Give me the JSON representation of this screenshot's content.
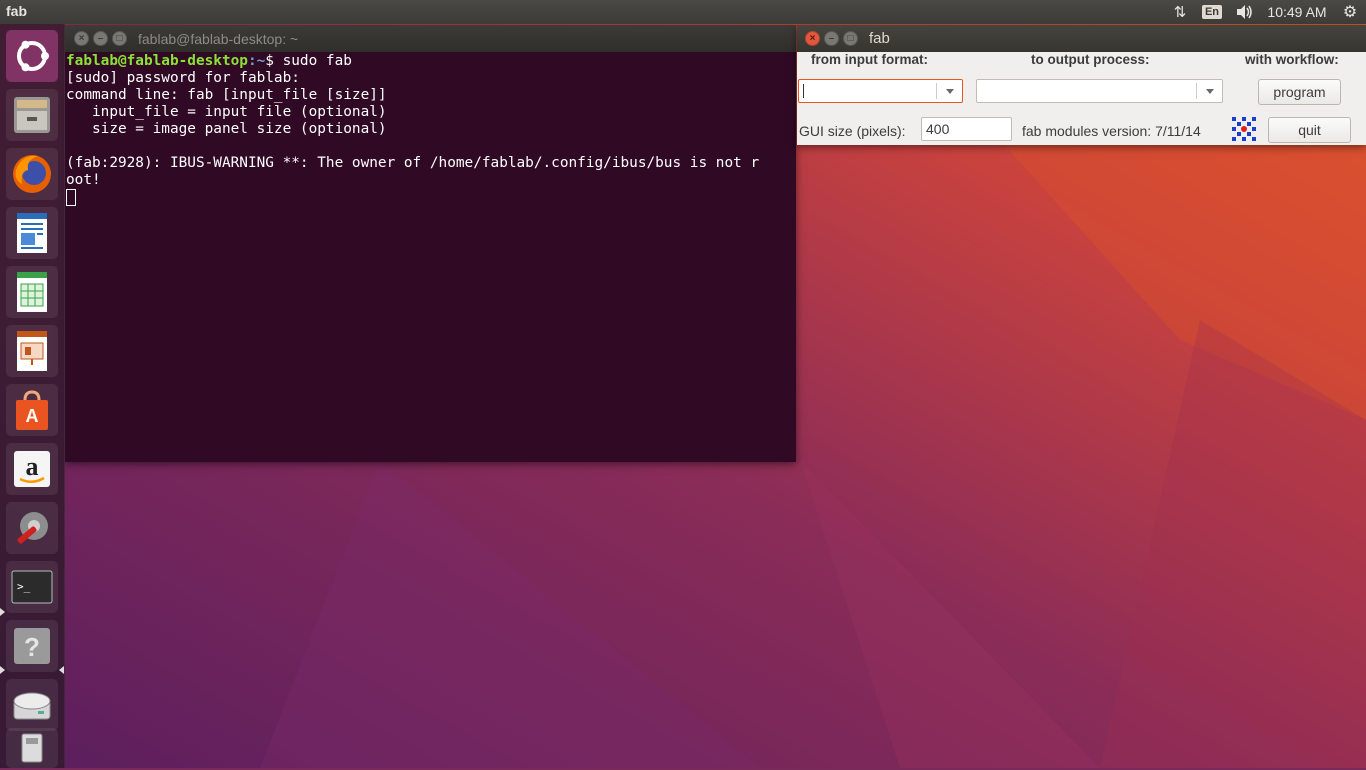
{
  "top_panel": {
    "app_name": "fab",
    "keyboard_layout": "En",
    "clock": "10:49 AM",
    "icons": [
      "network-icon",
      "keyboard-indicator",
      "volume-icon",
      "gear-icon"
    ]
  },
  "launcher": {
    "items": [
      {
        "name": "ubuntu-dash",
        "icon": "ubuntu-logo-icon"
      },
      {
        "name": "files",
        "icon": "file-cabinet-icon"
      },
      {
        "name": "firefox",
        "icon": "firefox-icon"
      },
      {
        "name": "libreoffice-writer",
        "icon": "writer-icon"
      },
      {
        "name": "libreoffice-calc",
        "icon": "calc-icon"
      },
      {
        "name": "libreoffice-impress",
        "icon": "impress-icon"
      },
      {
        "name": "ubuntu-software",
        "icon": "shopping-bag-icon"
      },
      {
        "name": "amazon",
        "icon": "amazon-icon"
      },
      {
        "name": "system-settings",
        "icon": "settings-wrench-icon"
      },
      {
        "name": "terminal",
        "icon": "terminal-icon"
      },
      {
        "name": "help",
        "icon": "help-question-icon"
      },
      {
        "name": "disk-drive",
        "icon": "hard-drive-icon"
      },
      {
        "name": "usb-drive",
        "icon": "usb-drive-icon"
      }
    ],
    "colors": {
      "ubuntu": "#dd4814",
      "amazon": "#ff9900"
    }
  },
  "terminal": {
    "title": "fablab@fablab-desktop: ~",
    "prompt_user": "fablab@fablab-desktop",
    "prompt_path": ":~",
    "prompt_symbol": "$ ",
    "command": "sudo fab",
    "lines": [
      "[sudo] password for fablab:",
      "command line: fab [input_file [size]]",
      "   input_file = input file (optional)",
      "   size = image panel size (optional)",
      "",
      "(fab:2928): IBUS-WARNING **: The owner of /home/fablab/.config/ibus/bus is not r",
      "oot!"
    ]
  },
  "fab_window": {
    "title": "fab",
    "from_label": "from input format:",
    "to_label": "to output process:",
    "workflow_label": "with workflow:",
    "from_value": "",
    "to_value": "",
    "program_button": "program",
    "gui_size_label": "GUI size (pixels):",
    "gui_size_value": "400",
    "version_label": "fab modules version: 7/11/14",
    "quit_button": "quit",
    "accent_color": "#e95420"
  }
}
